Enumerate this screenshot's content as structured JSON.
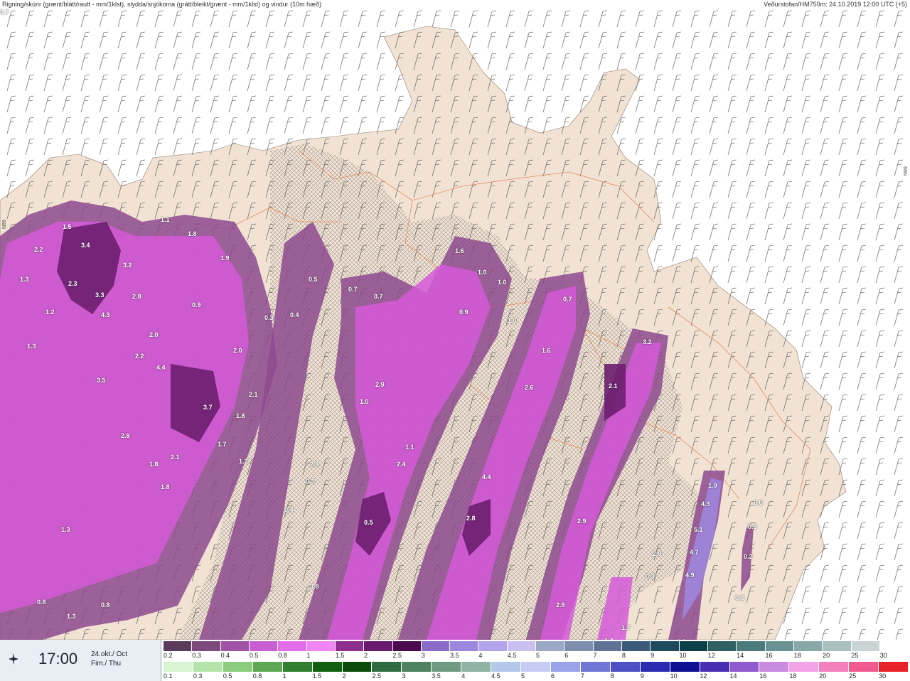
{
  "header": {
    "left_text": "Rigning/skúrir (grænt/blátt/rautt - mm/1klst), slydda/snjókoma (grátt/bleikt/grænt - mm/1klst) og vindur (10m hæð)",
    "right_text": "Veðurstofan/HM750m: 24.10.2019 12:00 UTC (+5)"
  },
  "map": {
    "side_label_left": "N99",
    "side_label_right": "N99",
    "colors": {
      "sea": "#ffffff",
      "land": "#f1e2d3",
      "roads": "#e88a5a"
    },
    "precip_labels": [
      "1.5",
      "2.2",
      "3.4",
      "1.3",
      "2.3",
      "3.2",
      "3.3",
      "2.8",
      "1.2",
      "4.3",
      "1.3",
      "2.0",
      "2.2",
      "4.4",
      "3.5",
      "1.1",
      "1.8",
      "1.9",
      "0.9",
      "2.0",
      "3.7",
      "2.1",
      "1.8",
      "1.7",
      "1.2",
      "2.8",
      "2.1",
      "1.8",
      "1.8",
      "1.3",
      "0.8",
      "0.8",
      "1.3",
      "0.3",
      "0.5",
      "0.4",
      "0.7",
      "0.7",
      "1.0",
      "1.6",
      "1.0",
      "0.9",
      "1.0",
      "0.7",
      "1.6",
      "2.6",
      "3.2",
      "2.1",
      "2.9",
      "1.0",
      "1.1",
      "2.4",
      "2.4",
      "0.3",
      "0.4",
      "0.5",
      "4.4",
      "2.8",
      "2.9",
      "2.9",
      "3.8",
      "1.7",
      "1.4",
      "1.9",
      "4.3",
      "5.1",
      "4.7",
      "4.9",
      "6.2",
      "2.9",
      "0.3",
      "0.3",
      "0.2",
      "0.5",
      "0.6",
      "0.7"
    ]
  },
  "footer": {
    "time": "17:00",
    "date_line1": "24.okt./ Oct",
    "date_line2": "Fim./ Thu",
    "icon": "settings-sparkle-icon",
    "scale_top": {
      "ticks": [
        "0.2",
        "0.3",
        "0.4",
        "0.5",
        "0.8",
        "1",
        "1.5",
        "2",
        "2.5",
        "3",
        "3.5",
        "4",
        "4.5",
        "5",
        "6",
        "7",
        "8",
        "9",
        "10",
        "12",
        "14",
        "16",
        "18",
        "20",
        "25",
        "30"
      ],
      "colors": [
        "#5b3a5c",
        "#7d4a7c",
        "#a154a6",
        "#c75ed1",
        "#e36ee9",
        "#f085f3",
        "#8e2e8f",
        "#6a1a6d",
        "#4b0a4e",
        "#8a6bc8",
        "#9d86dd",
        "#b3a3ea",
        "#c9c0f0",
        "#9ba9c4",
        "#7e8fae",
        "#5e7496",
        "#3c5a7a",
        "#1e4a5e",
        "#0c4048",
        "#2d5f63",
        "#4b7a7c",
        "#6a9293",
        "#8aa8aa",
        "#a9bebf",
        "#c9d4d5",
        "#ffffff"
      ]
    },
    "scale_bottom": {
      "ticks": [
        "0.1",
        "0.3",
        "0.5",
        "0.8",
        "1",
        "1.5",
        "2",
        "2.5",
        "3",
        "3.5",
        "4",
        "4.5",
        "5",
        "6",
        "7",
        "8",
        "9",
        "10",
        "12",
        "14",
        "16",
        "18",
        "20",
        "25",
        "30"
      ],
      "colors": [
        "#d8f5d2",
        "#b4e4a9",
        "#8ccc7e",
        "#5ea855",
        "#2f7f2f",
        "#106010",
        "#0a4b0a",
        "#2e6b3f",
        "#4f8360",
        "#6d9a80",
        "#8fb4a4",
        "#b3c9e8",
        "#c6cdf4",
        "#9aa3ea",
        "#6f78d9",
        "#4b50c6",
        "#2a2bb0",
        "#0f0f95",
        "#4a2fb3",
        "#8f5ccf",
        "#c98ae0",
        "#f2a3e8",
        "#f47fbf",
        "#f05a8e",
        "#e8202a"
      ]
    }
  }
}
